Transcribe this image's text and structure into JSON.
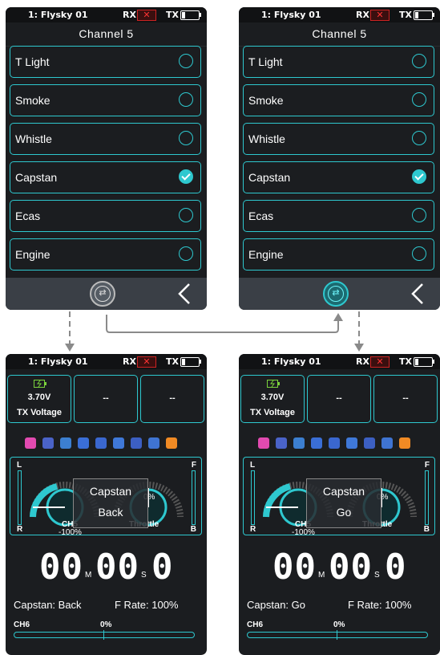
{
  "status": {
    "model": "1: Flysky  01",
    "rx": "RX",
    "rx_flag": "✕",
    "tx": "TX"
  },
  "select_screen": {
    "header": "Channel 5",
    "options": [
      "T  Light",
      "Smoke",
      "Whistle",
      "Capstan",
      "Ecas",
      "Engine"
    ],
    "selected": "Capstan"
  },
  "home": {
    "voltage_value": "3.70V",
    "voltage_label": "TX Voltage",
    "empty_box": "--",
    "left_dial_value": "-100%",
    "right_dial_value": "0%",
    "left_dial_label": "CH5",
    "right_dial_label": "Throttle",
    "scale_l": "L",
    "scale_r": "R",
    "scale_f": "F",
    "scale_b": "B",
    "timer": {
      "minutes": "00",
      "m_unit": "M",
      "seconds": "00",
      "s_unit": "S",
      "tenths": "0"
    },
    "f_rate": "F  Rate: 100%",
    "ch_bar_label": "CH6",
    "ch_bar_value": "0%"
  },
  "screens": {
    "bl": {
      "overlay_title": "Capstan",
      "overlay_state": "Back",
      "status_text": "Capstan: Back"
    },
    "br": {
      "overlay_title": "Capstan",
      "overlay_state": "Go",
      "status_text": "Capstan: Go"
    }
  },
  "colors": {
    "accent": "#2ec8cf",
    "screen_bg": "#1b1d20",
    "rx_red": "#cc2222"
  }
}
